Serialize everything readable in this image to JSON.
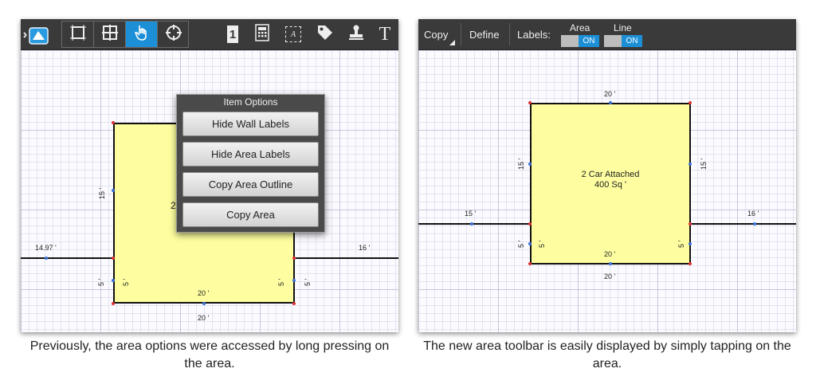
{
  "left_panel": {
    "toolbar": {
      "app_icon": "app-icon",
      "tools": [
        {
          "icon": "area-tool-icon"
        },
        {
          "icon": "grid-tool-icon"
        },
        {
          "icon": "hand-pointer-icon",
          "active": true
        },
        {
          "icon": "crosshair-icon"
        }
      ],
      "right_icons": [
        "number-one-icon",
        "calculator-icon",
        "text-box-icon",
        "tag-icon",
        "stamp-icon",
        "text-tool-icon"
      ],
      "text_tool_glyph": "T",
      "text_box_glyph": "A",
      "number_glyph": "1"
    },
    "menu": {
      "title": "Item Options",
      "items": [
        "Hide Wall Labels",
        "Hide Area Labels",
        "Copy Area Outline",
        "Copy Area"
      ]
    },
    "dims": {
      "top_left_wall": "14.97 '",
      "top_right_wall": "16 '",
      "left_side": "15 '",
      "left_small_outer": "5 '",
      "left_small_inner": "5 '",
      "right_small_inner": "5 '",
      "right_small_outer": "5 '",
      "bottom_inner": "20 '",
      "bottom_outer": "20 '",
      "area_fragment": "2"
    }
  },
  "right_panel": {
    "toolbar": {
      "copy_label": "Copy",
      "define_label": "Define",
      "labels_label": "Labels:",
      "area_toggle_label": "Area",
      "line_toggle_label": "Line",
      "area_toggle_state": "ON",
      "line_toggle_state": "ON"
    },
    "room": {
      "name": "2 Car Attached",
      "area": "400 Sq '"
    },
    "dims": {
      "top": "20 '",
      "left_side": "15 '",
      "right_side": "15 '",
      "left_wall": "15 '",
      "right_wall": "16 '",
      "left_small_outer": "5 '",
      "left_small_inner": "5 '",
      "right_small_inner": "5 '",
      "bottom_inner": "20 '",
      "bottom_outer": "20 '"
    }
  },
  "captions": {
    "left": "Previously, the area options were accessed by long pressing on the area.",
    "right": "The new area toolbar is easily displayed by simply tapping on the area."
  },
  "colors": {
    "toolbar_bg": "#3a3a3a",
    "accent": "#1c8fd6",
    "room_fill": "#fefea0",
    "grid_line": "#c8c8e0"
  }
}
